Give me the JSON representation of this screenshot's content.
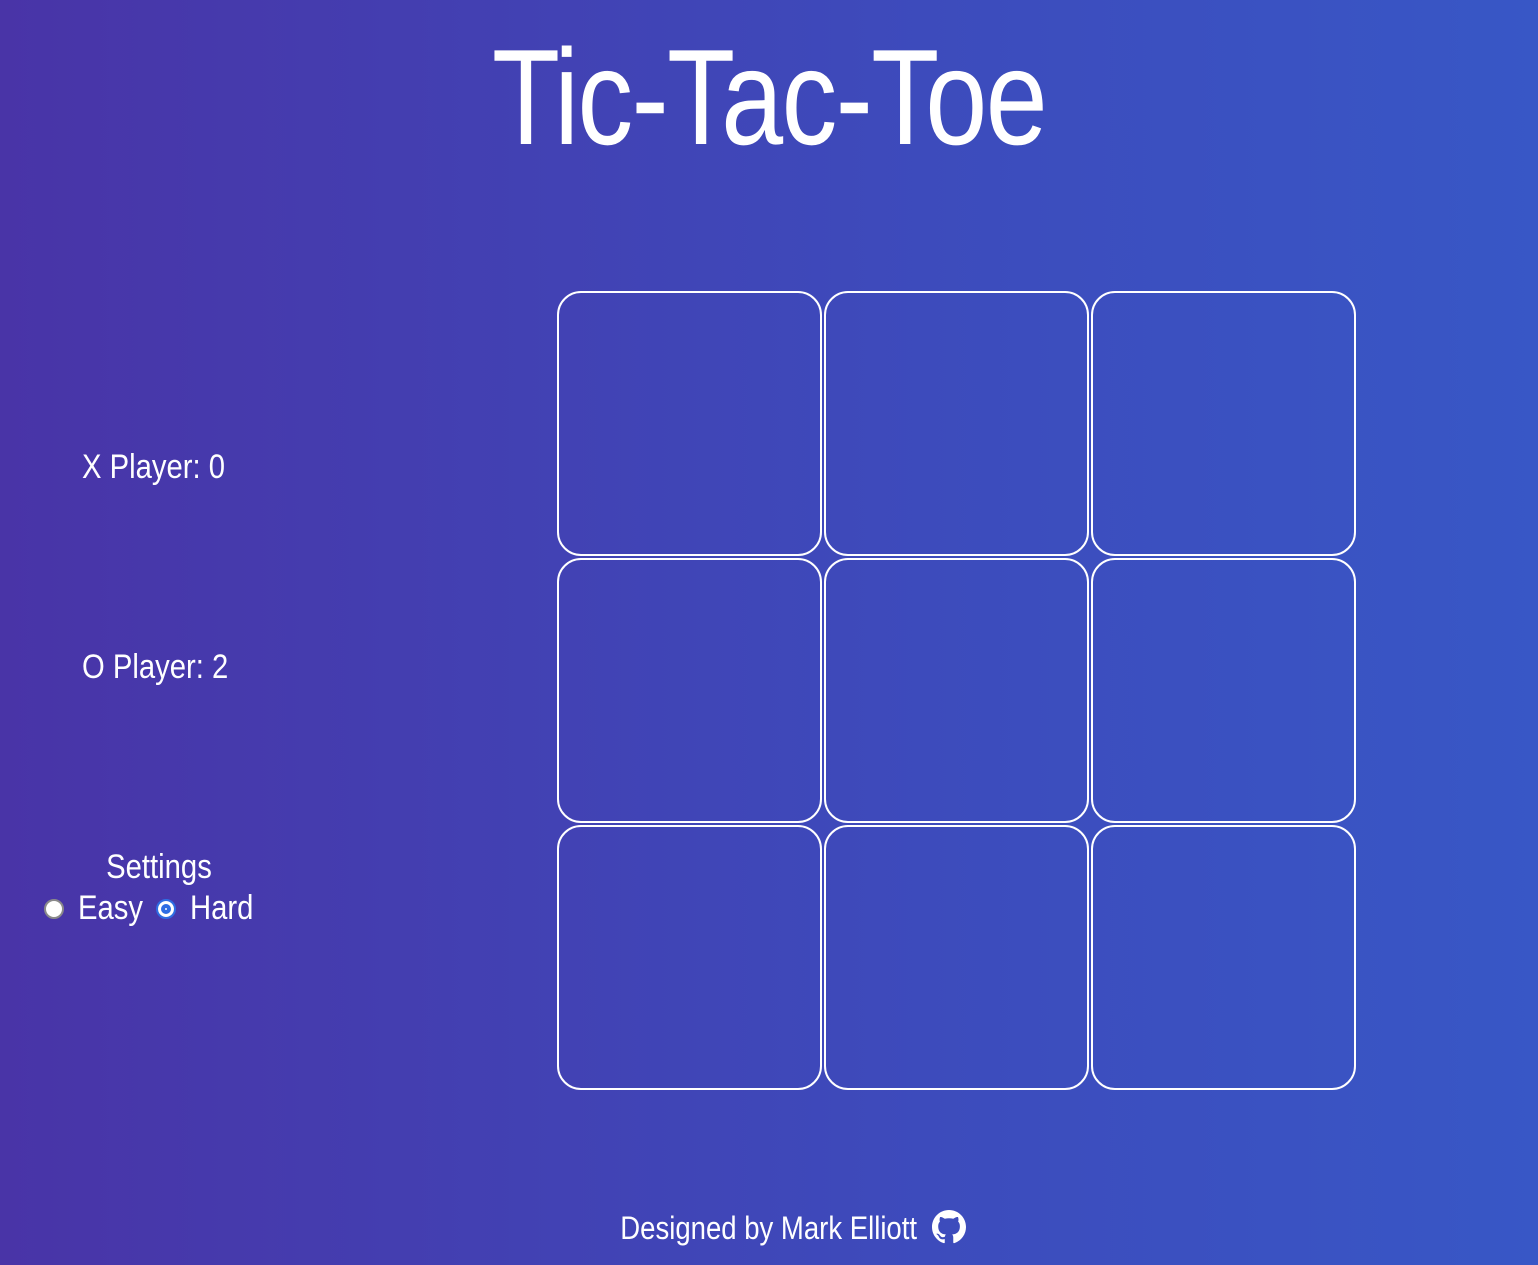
{
  "title": "Tic-Tac-Toe",
  "scores": {
    "x_label": "X Player: 0",
    "o_label": "O Player: 2"
  },
  "settings": {
    "title": "Settings",
    "options": [
      {
        "label": "Easy",
        "checked": false
      },
      {
        "label": "Hard",
        "checked": true
      }
    ]
  },
  "board": {
    "cells": [
      "",
      "",
      "",
      "",
      "",
      "",
      "",
      "",
      ""
    ]
  },
  "footer": {
    "text": "Designed by Mark Elliott",
    "icon": "github-icon"
  },
  "colors": {
    "background_start": "#4934a7",
    "background_end": "#3857c6",
    "foreground": "#ffffff",
    "radio_accent": "#2e6de3"
  }
}
